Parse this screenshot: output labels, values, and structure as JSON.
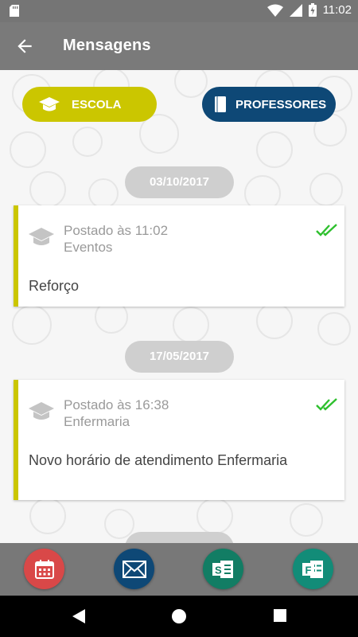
{
  "status_bar": {
    "time": "11:02"
  },
  "app_bar": {
    "title": "Mensagens"
  },
  "filters": {
    "escola_label": "ESCOLA",
    "professores_label": "PROFESSORES"
  },
  "messages": [
    {
      "date": "03/10/2017",
      "posted": "Postado às 11:02",
      "category": "Eventos",
      "body": "Reforço"
    },
    {
      "date": "17/05/2017",
      "posted": "Postado às 16:38",
      "category": "Enfermaria",
      "body": "Novo horário de atendimento Enfermaria"
    }
  ],
  "bottom_actions": [
    {
      "icon": "calendar-icon",
      "color": "#d94848"
    },
    {
      "icon": "mail-icon",
      "color": "#0e4876"
    },
    {
      "icon": "sharepoint-icon",
      "color": "#127d64"
    },
    {
      "icon": "forms-icon",
      "color": "#128c78"
    }
  ],
  "colors": {
    "escola": "#cbc600",
    "professores": "#0e4876",
    "app_bar": "#7a7a7a",
    "read_check": "#2ec02e"
  }
}
